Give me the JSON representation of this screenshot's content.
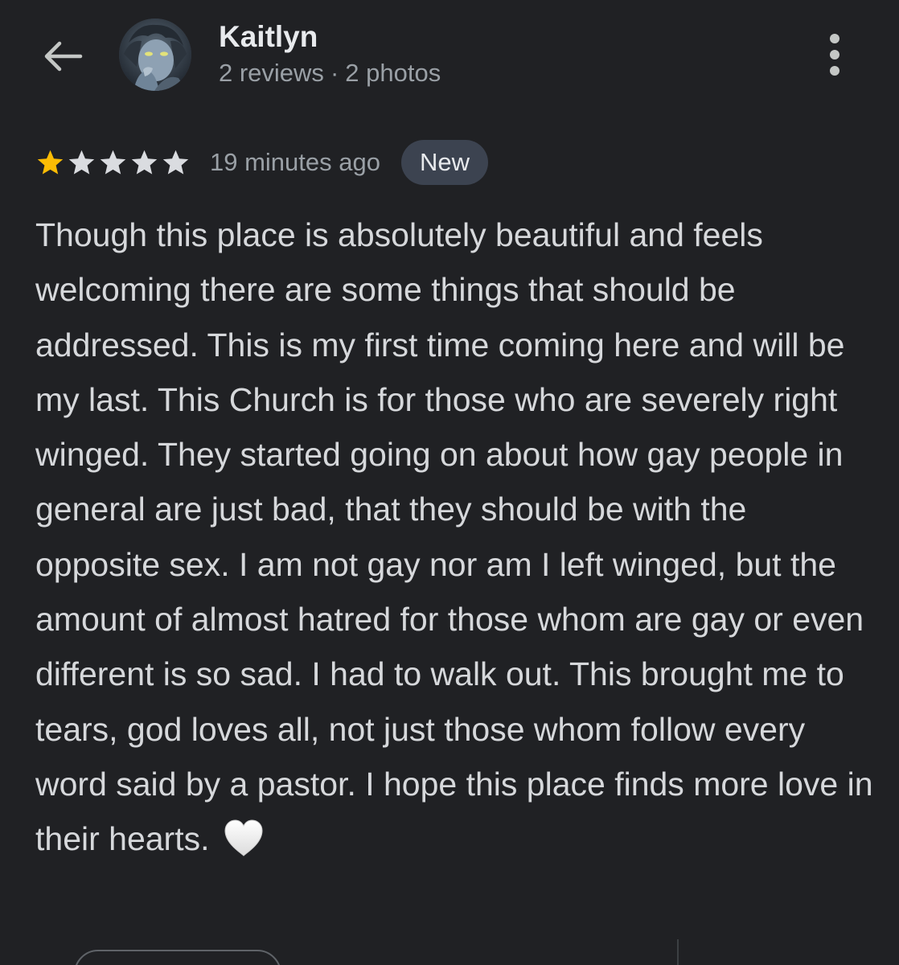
{
  "header": {
    "back_icon": "arrow-left-icon",
    "avatar_icon": "profile-avatar",
    "user_name": "Kaitlyn",
    "reviews_count": "2 reviews",
    "separator": "·",
    "photos_count": "2 photos",
    "more_icon": "more-vertical-icon"
  },
  "review": {
    "rating": 1,
    "rating_max": 5,
    "time_ago": "19 minutes ago",
    "badge": "New",
    "text": "Though this place is absolutely beautiful and feels welcoming there are some things that should be addressed. This is my first time coming here and will be my last. This Church is for those who are severely right winged. They started going on about how gay people in general are just bad, that they should be with the opposite sex. I am not gay nor am I left winged, but the amount of almost hatred for those whom are gay or even different is so sad. I had to walk out. This brought me to tears, god loves all, not just those whom follow every word said by a pastor. I hope this place finds more love in their hearts.",
    "emoji_icon": "white-heart-icon"
  },
  "colors": {
    "background": "#202124",
    "star_filled": "#fbbc04",
    "star_empty": "#dadce0",
    "badge_background": "#3c4350",
    "secondary_text": "#9aa0a6",
    "primary_text": "#e8eaed"
  }
}
